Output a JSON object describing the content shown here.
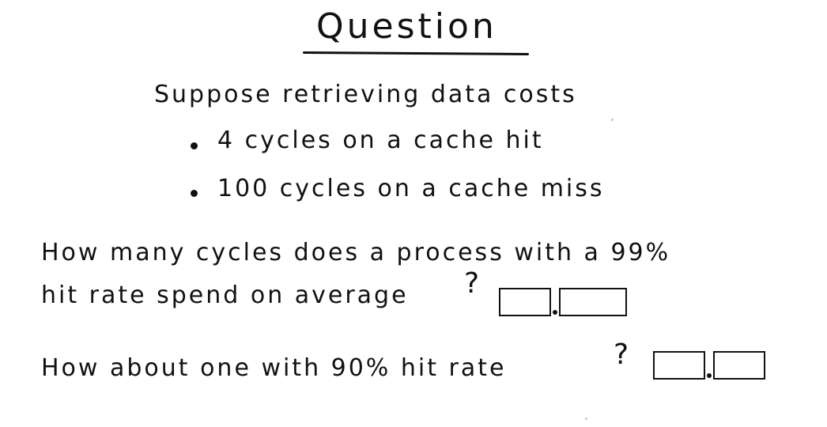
{
  "title": "Question",
  "intro": "Suppose retrieving data costs",
  "bullets": [
    "4 cycles on a cache hit",
    "100 cycles on a cache miss"
  ],
  "question1": {
    "line1": "How many cycles does a process with a 99%",
    "line2": "hit rate spend on average",
    "mark": "?"
  },
  "question2": {
    "text": "How about one with 90% hit rate",
    "mark": "?"
  }
}
